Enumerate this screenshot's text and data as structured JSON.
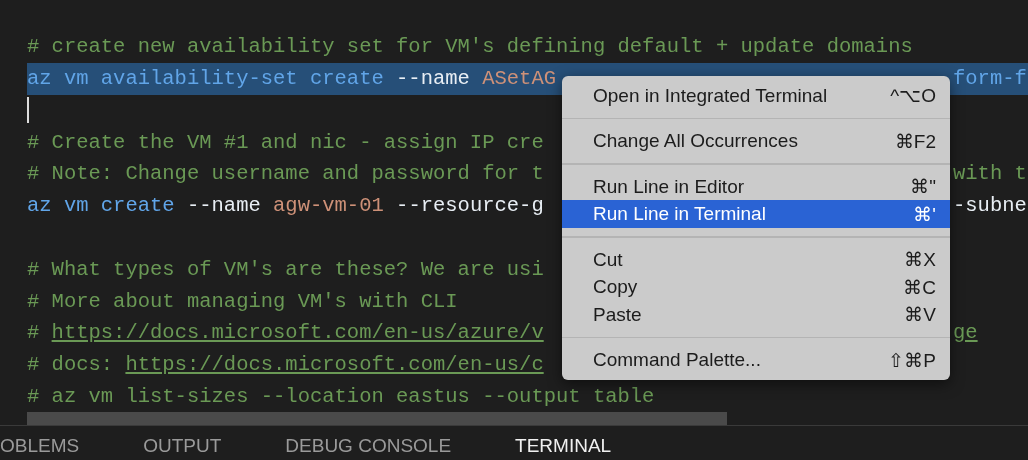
{
  "editor": {
    "lines": [
      {
        "selected": false,
        "tokens": [
          {
            "kind": "comment",
            "text": "# create new availability set for VM's defining default + update domains"
          }
        ]
      },
      {
        "selected": true,
        "tokens": [
          {
            "kind": "command",
            "text": "az vm availability-set create"
          },
          {
            "kind": "flag",
            "text": " --name"
          },
          {
            "kind": "value",
            "text": " ASetAG"
          }
        ],
        "right": [
          {
            "kind": "command",
            "text": "form-f"
          }
        ]
      },
      {
        "selected": false,
        "cursor": true
      },
      {
        "selected": false,
        "tokens": [
          {
            "kind": "comment",
            "text": "# Create the VM #1 and nic - assign IP cre"
          }
        ]
      },
      {
        "selected": false,
        "tokens": [
          {
            "kind": "comment",
            "text": "# Note: Change username and password for t"
          }
        ],
        "right": [
          {
            "kind": "comment",
            "text": "with t"
          }
        ]
      },
      {
        "selected": false,
        "tokens": [
          {
            "kind": "command",
            "text": "az vm create"
          },
          {
            "kind": "flag",
            "text": " --name"
          },
          {
            "kind": "value",
            "text": " agw-vm-01"
          },
          {
            "kind": "flag",
            "text": " --resource-g"
          }
        ],
        "right": [
          {
            "kind": "flag",
            "text": "-subne"
          }
        ]
      },
      {
        "selected": false
      },
      {
        "selected": false,
        "tokens": [
          {
            "kind": "comment",
            "text": "# What types of VM's are these? We are usi"
          }
        ]
      },
      {
        "selected": false,
        "tokens": [
          {
            "kind": "comment",
            "text": "# More about managing VM's with CLI"
          }
        ]
      },
      {
        "selected": false,
        "tokens": [
          {
            "kind": "comment",
            "text": "# "
          },
          {
            "kind": "link",
            "text": "https://docs.microsoft.com/en-us/azure/v"
          }
        ],
        "right": [
          {
            "kind": "link",
            "text": "ge"
          }
        ]
      },
      {
        "selected": false,
        "tokens": [
          {
            "kind": "comment",
            "text": "# docs: "
          },
          {
            "kind": "link",
            "text": "https://docs.microsoft.com/en-us/c"
          }
        ]
      },
      {
        "selected": false,
        "tokens": [
          {
            "kind": "comment",
            "text": "# az vm list-sizes --location eastus --output table"
          }
        ]
      }
    ]
  },
  "context_menu": {
    "groups": [
      [
        {
          "label": "Open in Integrated Terminal",
          "shortcut": "^⌥O",
          "selected": false
        }
      ],
      [
        {
          "label": "Change All Occurrences",
          "shortcut": "⌘F2",
          "selected": false
        }
      ],
      [
        {
          "label": "Run Line in Editor",
          "shortcut": "⌘\"",
          "selected": false
        },
        {
          "label": "Run Line in Terminal",
          "shortcut": "⌘'",
          "selected": true
        }
      ],
      [
        {
          "label": "Cut",
          "shortcut": "⌘X",
          "selected": false
        },
        {
          "label": "Copy",
          "shortcut": "⌘C",
          "selected": false
        },
        {
          "label": "Paste",
          "shortcut": "⌘V",
          "selected": false
        }
      ],
      [
        {
          "label": "Command Palette...",
          "shortcut": "⇧⌘P",
          "selected": false
        }
      ]
    ]
  },
  "panel_tabs": [
    {
      "label": "OBLEMS",
      "selected": false
    },
    {
      "label": "OUTPUT",
      "selected": false
    },
    {
      "label": "DEBUG CONSOLE",
      "selected": false
    },
    {
      "label": "TERMINAL",
      "selected": true
    }
  ]
}
